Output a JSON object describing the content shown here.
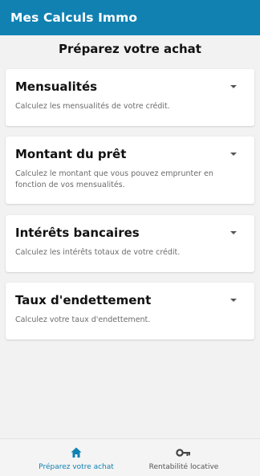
{
  "app": {
    "title": "Mes Calculs Immo"
  },
  "page": {
    "heading": "Préparez votre achat"
  },
  "cards": [
    {
      "title": "Mensualités",
      "description": "Calculez les mensualités de votre crédit."
    },
    {
      "title": "Montant du prêt",
      "description": "Calculez le montant que vous pouvez emprunter en fonction de vos mensualités."
    },
    {
      "title": "Intérêts bancaires",
      "description": "Calculez les intérêts totaux de votre crédit."
    },
    {
      "title": "Taux d'endettement",
      "description": "Calculez votre taux d'endettement."
    }
  ],
  "nav": {
    "items": [
      {
        "label": "Préparez votre achat",
        "icon": "home-icon",
        "active": true
      },
      {
        "label": "Rentabilité locative",
        "icon": "key-icon",
        "active": false
      }
    ]
  },
  "colors": {
    "primary": "#1181b2",
    "background": "#f2f2f2",
    "card": "#ffffff",
    "muted_text": "#6b6b6b"
  }
}
